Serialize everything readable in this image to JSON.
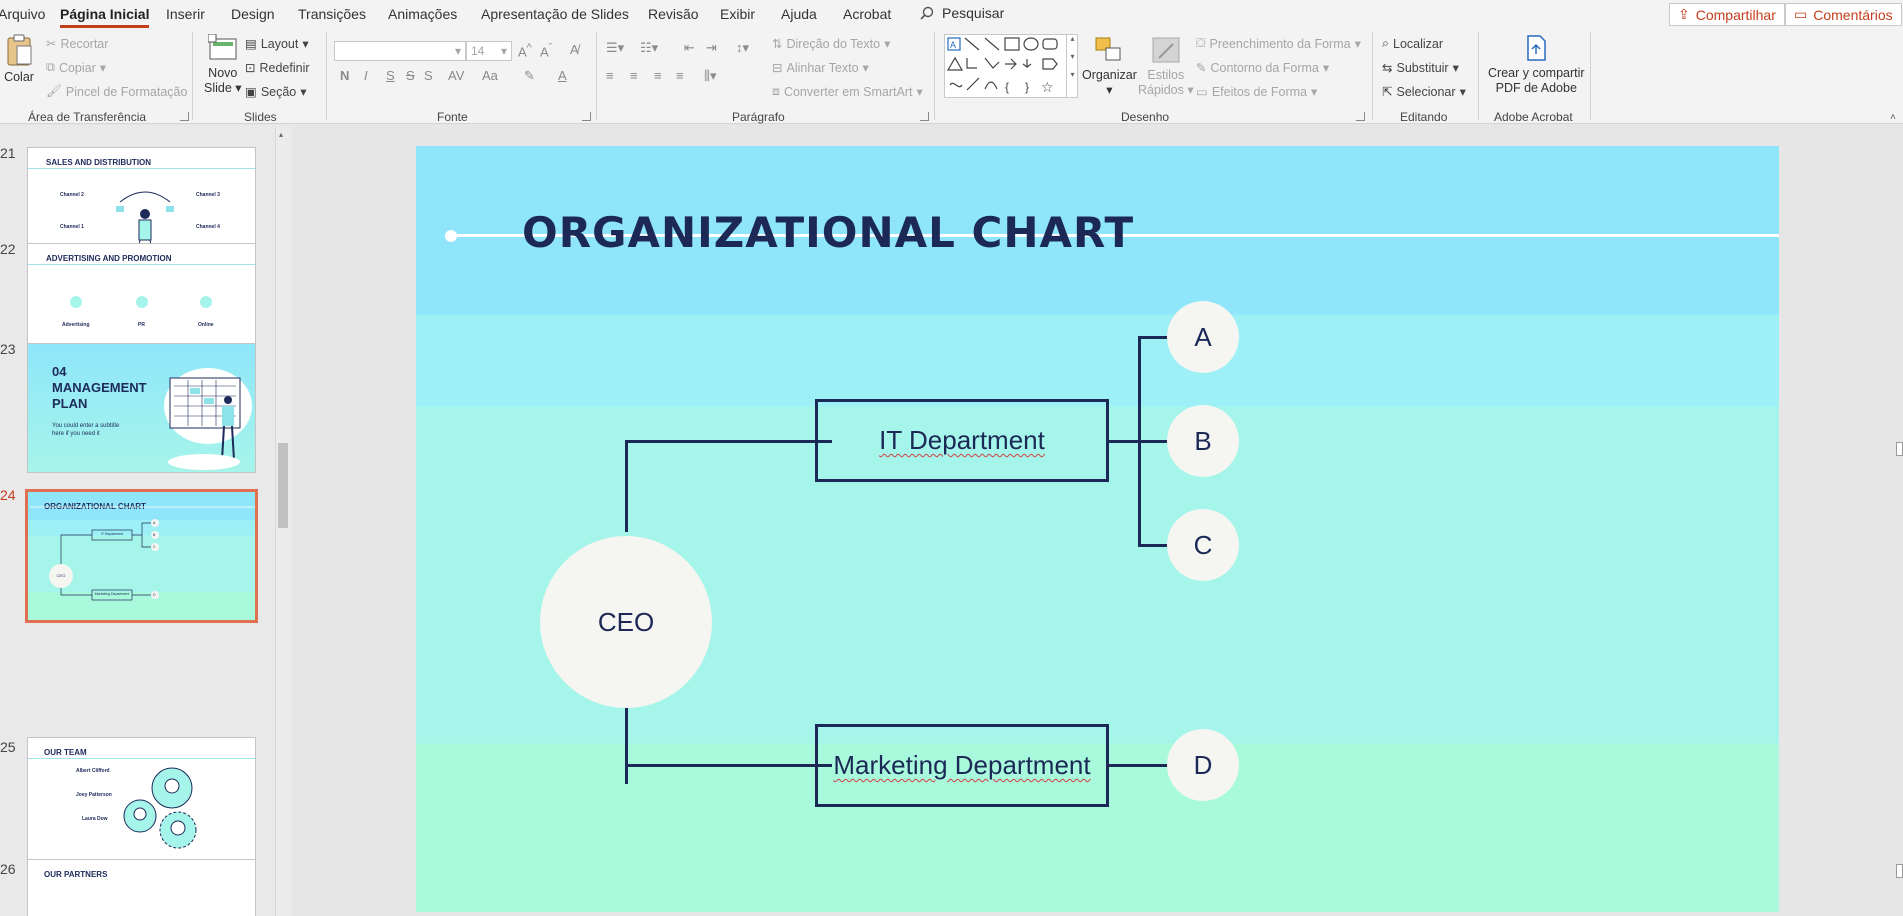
{
  "menu": {
    "tabs": [
      "Arquivo",
      "Página Inicial",
      "Inserir",
      "Design",
      "Transições",
      "Animações",
      "Apresentação de Slides",
      "Revisão",
      "Exibir",
      "Ajuda",
      "Acrobat"
    ],
    "search": "Pesquisar",
    "share": "Compartilhar",
    "comments": "Comentários"
  },
  "ribbon": {
    "clipboard": {
      "paste": "Colar",
      "cut": "Recortar",
      "copy": "Copiar",
      "format_painter": "Pincel de Formatação",
      "label": "Área de Transferência"
    },
    "slides": {
      "new_slide_1": "Novo",
      "new_slide_2": "Slide",
      "layout": "Layout",
      "reset": "Redefinir",
      "section": "Seção",
      "label": "Slides"
    },
    "font": {
      "size": "14",
      "bold": "N",
      "italic": "I",
      "underline": "S",
      "strike": "S",
      "spacing": "AV",
      "case": "Aa",
      "label": "Fonte"
    },
    "paragraph": {
      "text_direction": "Direção do Texto",
      "align_text": "Alinhar Texto",
      "smartart": "Converter em SmartArt",
      "label": "Parágrafo"
    },
    "drawing": {
      "arrange": "Organizar",
      "quick_styles_1": "Estilos",
      "quick_styles_2": "Rápidos",
      "fill": "Preenchimento da Forma",
      "outline": "Contorno da Forma",
      "effects": "Efeitos de Forma",
      "label": "Desenho"
    },
    "editing": {
      "find": "Localizar",
      "replace": "Substituir",
      "select": "Selecionar",
      "label": "Editando"
    },
    "acrobat": {
      "create_1": "Crear y compartir",
      "create_2": "PDF de Adobe",
      "label": "Adobe Acrobat"
    }
  },
  "thumbnails": [
    {
      "num": "21",
      "title": "SALES AND DISTRIBUTION",
      "ch2": "Channel 2",
      "ch3": "Channel 3",
      "ch1": "Channel 1",
      "ch4": "Channel 4"
    },
    {
      "num": "22",
      "title": "ADVERTISING AND PROMOTION",
      "c1": "Advertising",
      "c2": "PR",
      "c3": "Online"
    },
    {
      "num": "23",
      "title_1": "04",
      "title_2": "MANAGEMENT",
      "title_3": "PLAN",
      "subtitle_1": "You could enter a subtitle",
      "subtitle_2": "here if you need it"
    },
    {
      "num": "24",
      "title": "ORGANIZATIONAL CHART",
      "it": "IT Department",
      "mk": "Marketing Department",
      "ceo": "CEO",
      "a": "A",
      "b": "B",
      "c": "C",
      "d": "D"
    },
    {
      "num": "25",
      "title": "OUR TEAM",
      "p1": "Albert Clifford",
      "p2": "Joey Patterson",
      "p3": "Laura Dow"
    },
    {
      "num": "26",
      "title": "OUR PARTNERS"
    }
  ],
  "slide": {
    "title": "ORGANIZATIONAL CHART",
    "ceo": "CEO",
    "it_department": "IT Department",
    "marketing_department": "Marketing Department",
    "nodes": [
      "A",
      "B",
      "C",
      "D"
    ]
  }
}
